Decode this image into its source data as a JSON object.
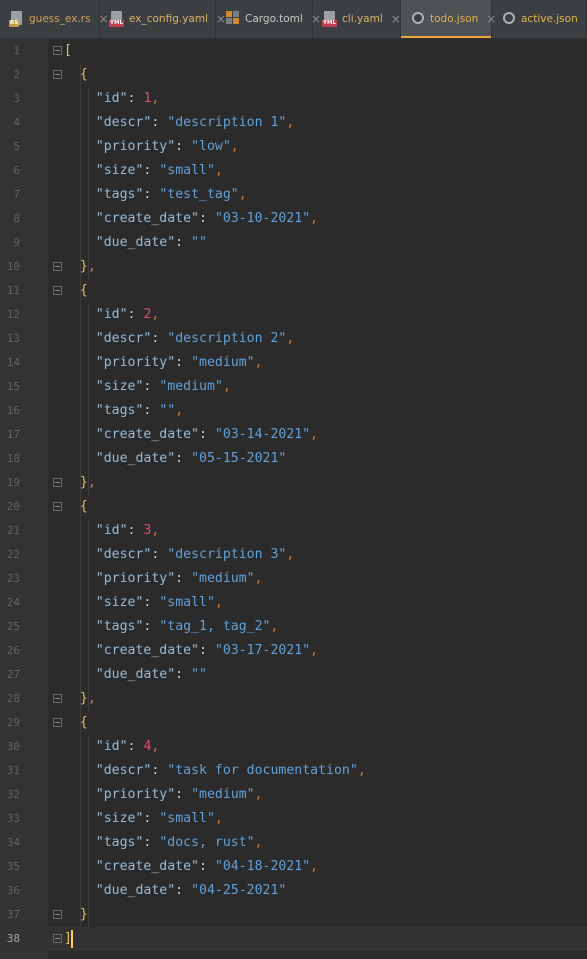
{
  "tabs": [
    {
      "label": "guess_ex.rs",
      "icon": "rust-file-icon",
      "badge": "RS",
      "badge_color": "#c0a040",
      "kind": "mod",
      "active": false
    },
    {
      "label": "ex_config.yaml",
      "icon": "yaml-file-icon",
      "badge": "YML",
      "badge_color": "#c04050",
      "kind": "yaml",
      "active": false
    },
    {
      "label": "Cargo.toml",
      "icon": "toml-file-icon",
      "badge": "",
      "badge_color": "#d08a30",
      "kind": "toml",
      "active": false
    },
    {
      "label": "cli.yaml",
      "icon": "yaml-file-icon",
      "badge": "YML",
      "badge_color": "#c04050",
      "kind": "yaml",
      "active": false
    },
    {
      "label": "todo.json",
      "icon": "json-file-icon",
      "badge": "",
      "badge_color": "#aab0b6",
      "kind": "json",
      "active": true
    },
    {
      "label": "active.json",
      "icon": "json-file-icon",
      "badge": "",
      "badge_color": "#aab0b6",
      "kind": "json",
      "active": false
    }
  ],
  "colors": {
    "key": "#9bb9d4",
    "string": "#62a0d8",
    "number": "#d8506a",
    "bracket": "#e8c05a",
    "tab_accent": "#e8a33b"
  },
  "editor": {
    "current_line": 38,
    "lines": [
      "[",
      "  {",
      "    \"id\": 1,",
      "    \"descr\": \"description 1\",",
      "    \"priority\": \"low\",",
      "    \"size\": \"small\",",
      "    \"tags\": \"test_tag\",",
      "    \"create_date\": \"03-10-2021\",",
      "    \"due_date\": \"\"",
      "  },",
      "  {",
      "    \"id\": 2,",
      "    \"descr\": \"description 2\",",
      "    \"priority\": \"medium\",",
      "    \"size\": \"medium\",",
      "    \"tags\": \"\",",
      "    \"create_date\": \"03-14-2021\",",
      "    \"due_date\": \"05-15-2021\"",
      "  },",
      "  {",
      "    \"id\": 3,",
      "    \"descr\": \"description 3\",",
      "    \"priority\": \"medium\",",
      "    \"size\": \"small\",",
      "    \"tags\": \"tag_1, tag_2\",",
      "    \"create_date\": \"03-17-2021\",",
      "    \"due_date\": \"\"",
      "  },",
      "  {",
      "    \"id\": 4,",
      "    \"descr\": \"task for documentation\",",
      "    \"priority\": \"medium\",",
      "    \"size\": \"small\",",
      "    \"tags\": \"docs, rust\",",
      "    \"create_date\": \"04-18-2021\",",
      "    \"due_date\": \"04-25-2021\"",
      "  }",
      "]"
    ],
    "fold_lines": [
      1,
      2,
      10,
      11,
      19,
      20,
      28,
      29,
      37,
      38
    ]
  }
}
